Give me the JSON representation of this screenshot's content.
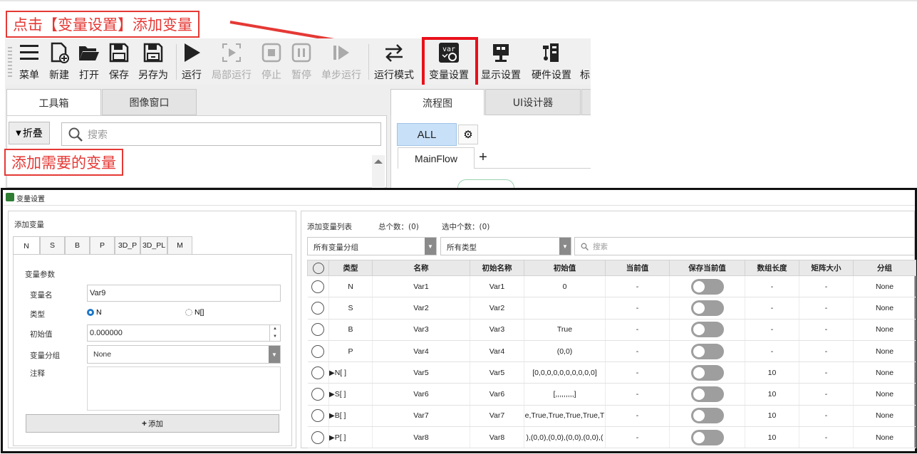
{
  "callouts": {
    "top": "点击【变量设置】添加变量",
    "middle": "添加需要的变量"
  },
  "toolbar": {
    "items": [
      {
        "label": "菜单",
        "icon": "menu-icon",
        "disabled": false
      },
      {
        "label": "新建",
        "icon": "new-file-icon",
        "disabled": false
      },
      {
        "label": "打开",
        "icon": "folder-open-icon",
        "disabled": false
      },
      {
        "label": "保存",
        "icon": "save-icon",
        "disabled": false
      },
      {
        "label": "另存为",
        "icon": "save-as-icon",
        "disabled": false
      },
      {
        "label": "运行",
        "icon": "play-icon",
        "disabled": false
      },
      {
        "label": "局部运行",
        "icon": "partial-run-icon",
        "disabled": true
      },
      {
        "label": "停止",
        "icon": "stop-icon",
        "disabled": true
      },
      {
        "label": "暂停",
        "icon": "pause-icon",
        "disabled": true
      },
      {
        "label": "单步运行",
        "icon": "step-run-icon",
        "disabled": true
      },
      {
        "label": "运行模式",
        "icon": "run-mode-icon",
        "disabled": false
      },
      {
        "label": "变量设置",
        "icon": "variable-settings-icon",
        "disabled": false
      },
      {
        "label": "显示设置",
        "icon": "display-settings-icon",
        "disabled": false
      },
      {
        "label": "硬件设置",
        "icon": "hardware-settings-icon",
        "disabled": false
      },
      {
        "label": "标",
        "icon": "",
        "disabled": false
      }
    ],
    "var_icon_text": "var"
  },
  "left_tabs": [
    "工具箱",
    "图像窗口"
  ],
  "collapse_label": "折叠",
  "search_placeholder": "搜索",
  "right_tabs": [
    "流程图",
    "UI设计器"
  ],
  "flow": {
    "all_label": "ALL",
    "mainflow_label": "MainFlow",
    "add_symbol": "+"
  },
  "dialog": {
    "title": "变量设置",
    "left": {
      "header": "添加变量",
      "type_tabs": [
        "N",
        "S",
        "B",
        "P",
        "3D_P",
        "3D_PL",
        "M"
      ],
      "params_title": "变量参数",
      "name_label": "变量名",
      "name_value": "Var9",
      "type_label": "类型",
      "type_options": [
        "N",
        "N[]"
      ],
      "init_label": "初始值",
      "init_value": "0.000000",
      "group_label": "变量分组",
      "group_value": "None",
      "comment_label": "注释",
      "add_button": "添加",
      "add_symbol": "+"
    },
    "right": {
      "header": "添加变量列表",
      "total_label": "总个数：(0)",
      "selected_label": "选中个数：(0)",
      "group_filter": "所有变量分组",
      "type_filter": "所有类型",
      "search_placeholder": "搜索",
      "columns": [
        "类型",
        "名称",
        "初始名称",
        "初始值",
        "当前值",
        "保存当前值",
        "数组长度",
        "矩阵大小",
        "分组"
      ],
      "rows": [
        {
          "type": "N",
          "expand": false,
          "name": "Var1",
          "init_name": "Var1",
          "init_value": "0",
          "current": "-",
          "array_len": "-",
          "matrix": "-",
          "group": "None"
        },
        {
          "type": "S",
          "expand": false,
          "name": "Var2",
          "init_name": "Var2",
          "init_value": "",
          "current": "-",
          "array_len": "-",
          "matrix": "-",
          "group": "None"
        },
        {
          "type": "B",
          "expand": false,
          "name": "Var3",
          "init_name": "Var3",
          "init_value": "True",
          "current": "-",
          "array_len": "-",
          "matrix": "-",
          "group": "None"
        },
        {
          "type": "P",
          "expand": false,
          "name": "Var4",
          "init_name": "Var4",
          "init_value": "(0,0)",
          "current": "-",
          "array_len": "-",
          "matrix": "-",
          "group": "None"
        },
        {
          "type": "N[ ]",
          "expand": true,
          "name": "Var5",
          "init_name": "Var5",
          "init_value": "[0,0,0,0,0,0,0,0,0,0]",
          "current": "-",
          "array_len": "10",
          "matrix": "-",
          "group": "None"
        },
        {
          "type": "S[ ]",
          "expand": true,
          "name": "Var6",
          "init_name": "Var6",
          "init_value": "[,,,,,,,,,]",
          "current": "-",
          "array_len": "10",
          "matrix": "-",
          "group": "None"
        },
        {
          "type": "B[ ]",
          "expand": true,
          "name": "Var7",
          "init_name": "Var7",
          "init_value": "e,True,True,True,True,T",
          "current": "-",
          "array_len": "10",
          "matrix": "-",
          "group": "None"
        },
        {
          "type": "P[ ]",
          "expand": true,
          "name": "Var8",
          "init_name": "Var8",
          "init_value": "),(0,0),(0,0),(0,0),(0,0),(",
          "current": "-",
          "array_len": "10",
          "matrix": "-",
          "group": "None"
        }
      ]
    }
  },
  "colors": {
    "accent_blue": "#c9e1f8",
    "callout_red": "#e53935",
    "toggle_off": "#9e9e9e"
  }
}
